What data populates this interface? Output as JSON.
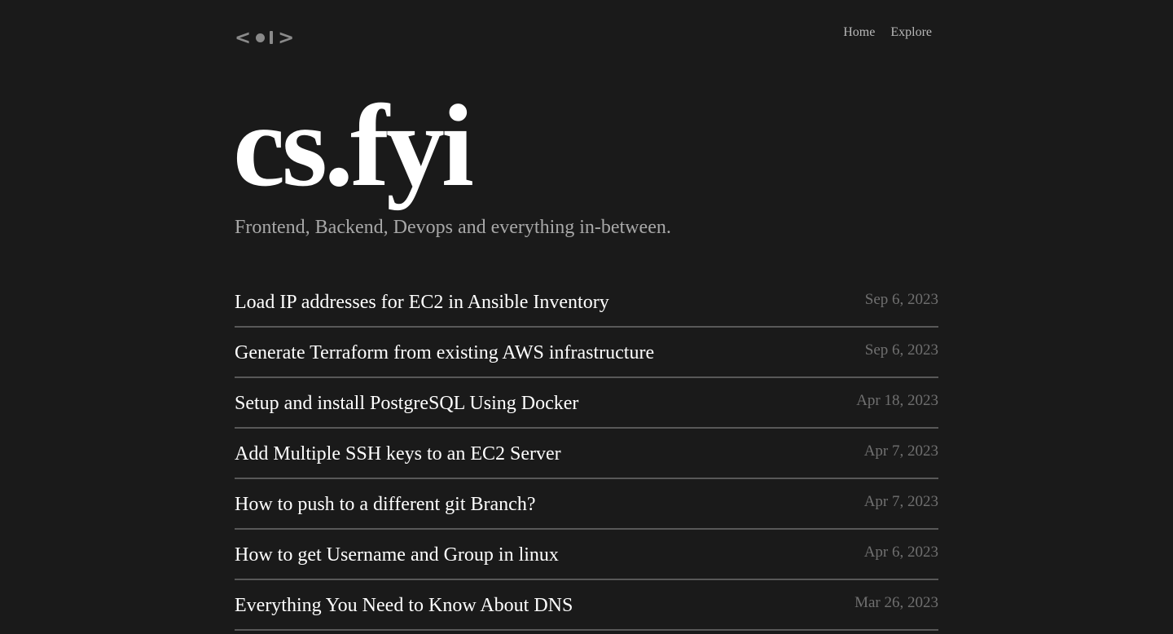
{
  "header": {
    "logo_icon": "code-brackets-logo",
    "nav": [
      {
        "label": "Home"
      },
      {
        "label": "Explore"
      }
    ]
  },
  "hero": {
    "title": "cs.fyi",
    "tagline": "Frontend, Backend, Devops and everything in-between."
  },
  "posts": [
    {
      "title": "Load IP addresses for EC2 in Ansible Inventory",
      "date": "Sep 6, 2023"
    },
    {
      "title": "Generate Terraform from existing AWS infrastructure",
      "date": "Sep 6, 2023"
    },
    {
      "title": "Setup and install PostgreSQL Using Docker",
      "date": "Apr 18, 2023"
    },
    {
      "title": "Add Multiple SSH keys to an EC2 Server",
      "date": "Apr 7, 2023"
    },
    {
      "title": "How to push to a different git Branch?",
      "date": "Apr 7, 2023"
    },
    {
      "title": "How to get Username and Group in linux",
      "date": "Apr 6, 2023"
    },
    {
      "title": "Everything You Need to Know About DNS",
      "date": "Mar 26, 2023"
    }
  ],
  "colors": {
    "background": "#1a1a1a",
    "text": "#ffffff",
    "muted": "#a8a8a8",
    "date": "#707070",
    "divider": "#585858"
  }
}
